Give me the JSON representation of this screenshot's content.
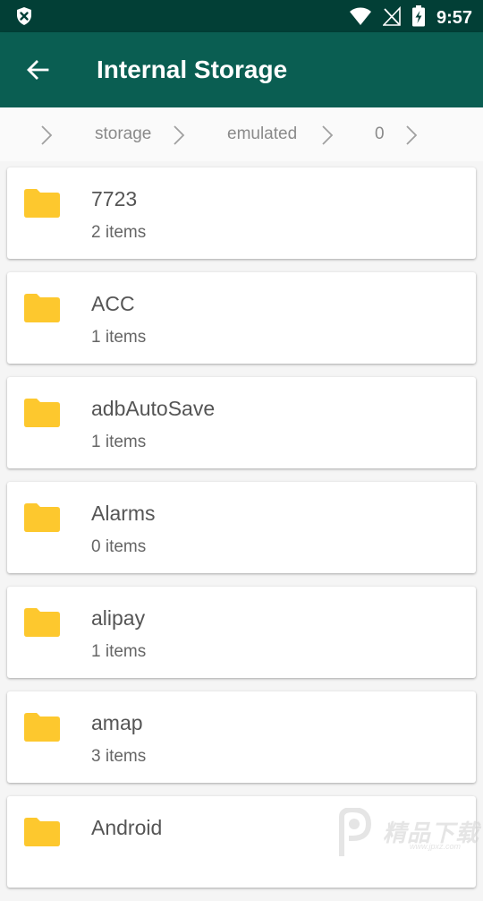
{
  "status_bar": {
    "time": "9:57",
    "icons": [
      "shield-close-icon",
      "wifi-icon",
      "no-signal-icon",
      "battery-charging-icon"
    ]
  },
  "app_bar": {
    "back_icon": "arrow-back-icon",
    "title": "Internal Storage",
    "background": "#0a5e52"
  },
  "breadcrumb": {
    "items": [
      "storage",
      "emulated",
      "0"
    ]
  },
  "folders": [
    {
      "name": "7723",
      "count": "2 items"
    },
    {
      "name": "ACC",
      "count": "1 items"
    },
    {
      "name": "adbAutoSave",
      "count": "1 items"
    },
    {
      "name": "Alarms",
      "count": "0 items"
    },
    {
      "name": "alipay",
      "count": "1 items"
    },
    {
      "name": "amap",
      "count": "3 items"
    },
    {
      "name": "Android",
      "count": ""
    }
  ],
  "colors": {
    "status_bar": "#023f36",
    "folder": "#fdc82e"
  },
  "watermark": {
    "logo_text": "精品下载",
    "url": "www.jpxz.com"
  }
}
